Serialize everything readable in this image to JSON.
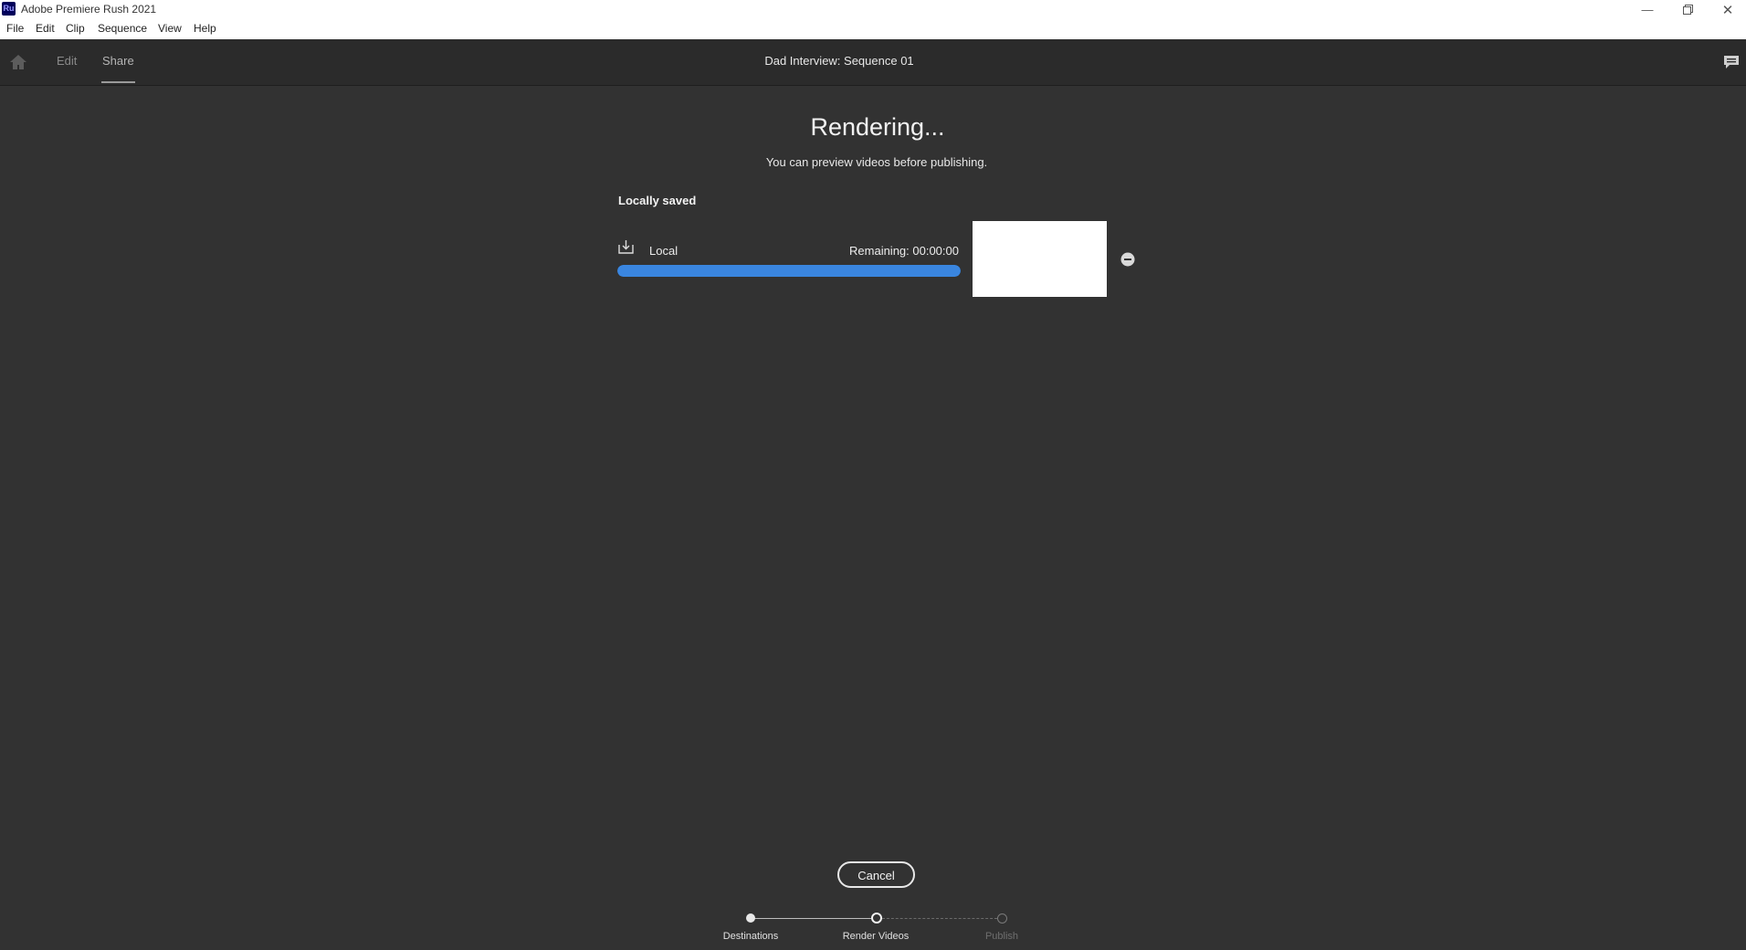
{
  "window": {
    "app_icon": "Ru",
    "title": "Adobe Premiere Rush 2021",
    "controls": [
      "minimize-icon",
      "restore-icon",
      "close-icon"
    ]
  },
  "menu": {
    "items": [
      "File",
      "Edit",
      "Clip",
      "Sequence",
      "View",
      "Help"
    ]
  },
  "header": {
    "home_icon": "home-icon",
    "tabs": [
      {
        "label": "Edit",
        "active": false
      },
      {
        "label": "Share",
        "active": true
      }
    ],
    "sequence_title": "Dad Interview: Sequence 01",
    "chat_icon": "chat-icon"
  },
  "main": {
    "heading": "Rendering...",
    "subheading": "You can preview videos before publishing.",
    "section_label": "Locally saved",
    "render_item": {
      "icon": "download-icon",
      "destination": "Local",
      "remaining": "Remaining: 00:00:00",
      "progress": 1.0,
      "progress_color": "#3a86e0",
      "remove_icon": "minus-circle-icon"
    }
  },
  "footer": {
    "cancel_label": "Cancel",
    "steps": [
      {
        "label": "Destinations",
        "state": "done"
      },
      {
        "label": "Render Videos",
        "state": "current"
      },
      {
        "label": "Publish",
        "state": "future"
      }
    ]
  }
}
